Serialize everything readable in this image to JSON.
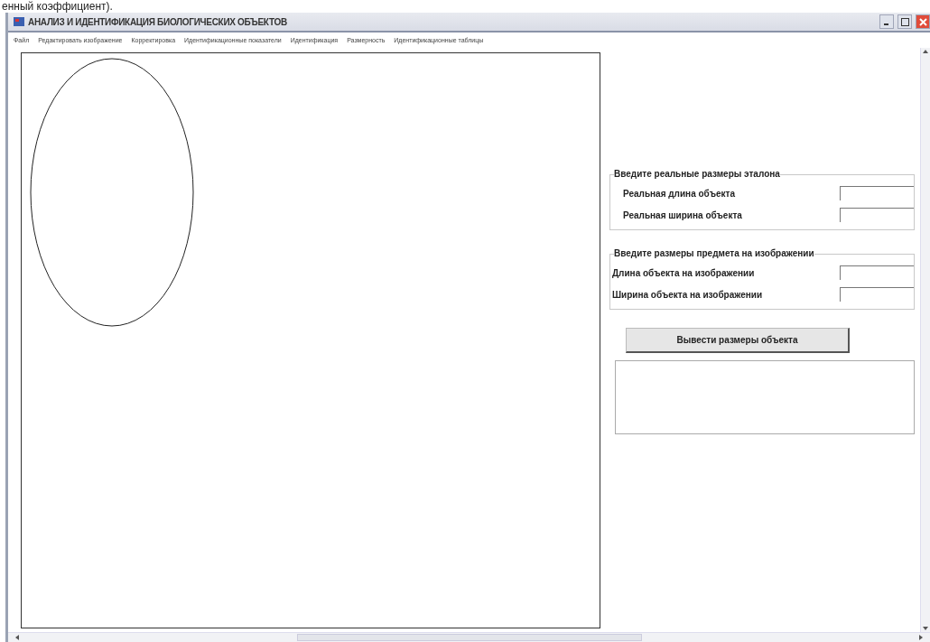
{
  "caption": "енный коэффициент).",
  "window": {
    "title": "АНАЛИЗ И ИДЕНТИФИКАЦИЯ БИОЛОГИЧЕСКИХ ОБЪЕКТОВ"
  },
  "menu": [
    "Файл",
    "Редактировать изображение",
    "Корректировка",
    "Идентификационные показатели",
    "Идентификация",
    "Размерность",
    "Идентификационные таблицы"
  ],
  "groups": [
    {
      "title": "Введите реальные размеры эталона",
      "fields": [
        {
          "label": "Реальная длина объекта"
        },
        {
          "label": "Реальная ширина объекта"
        }
      ]
    },
    {
      "title": "Введите размеры предмета на изображении",
      "fields": [
        {
          "label": "Длина объекта на изображении"
        },
        {
          "label": "Ширина объекта на изображении"
        }
      ]
    }
  ],
  "button": "Вывести размеры объекта"
}
